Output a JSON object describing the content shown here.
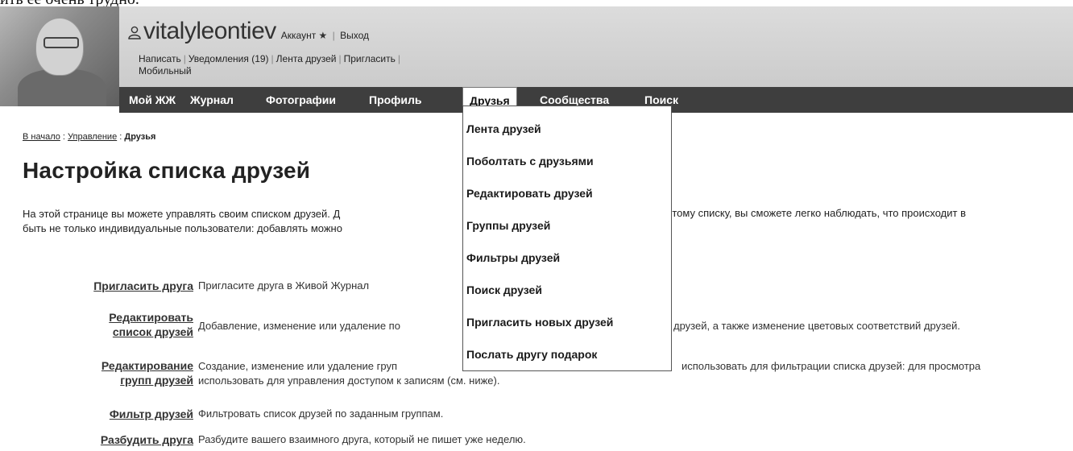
{
  "page_top_cut": "ить ее очень трудно.",
  "header": {
    "username": "vitalyleontiev",
    "account_link": "Аккаунт",
    "logout_link": "Выход",
    "sub_links": [
      "Написать",
      "Уведомления (19)",
      "Лента друзей",
      "Пригласить",
      "Мобильный"
    ]
  },
  "nav": {
    "items": [
      "Мой ЖЖ",
      "Журнал",
      "Фотографии",
      "Профиль",
      "Друзья",
      "Сообщества",
      "Поиск"
    ],
    "active_index": 4
  },
  "dropdown": {
    "items": [
      "Лента друзей",
      "Поболтать с друзьями",
      "Редактировать друзей",
      "Группы друзей",
      "Фильтры друзей",
      "Поиск друзей",
      "Пригласить новых друзей",
      "Послать другу подарок"
    ]
  },
  "breadcrumb": {
    "home": "В начало",
    "manage": "Управление",
    "current": "Друзья"
  },
  "page_title": "Настройка списка друзей",
  "intro": {
    "line1": "На этой странице вы можете управлять своим списком друзей. Д",
    "line1_end": "этому списку, вы сможете легко наблюдать, что происходит в",
    "line2": "быть не только индивидуальные пользователи: добавлять можно"
  },
  "rows": [
    {
      "link": [
        "Пригласить друга"
      ],
      "desc": [
        "Пригласите друга в Живой Журнал"
      ]
    },
    {
      "link": [
        "Редактировать",
        "список друзей"
      ],
      "desc": [
        "Добавление, изменение или удаление по",
        "друзей, а также изменение цветовых соответствий друзей."
      ]
    },
    {
      "link": [
        "Редактирование",
        "групп друзей"
      ],
      "desc": [
        "Создание, изменение или удаление груп",
        "использовать для фильтрации списка друзей: для просмотра",
        "использовать для управления доступом к записям (см. ниже)."
      ]
    },
    {
      "link": [
        "Фильтр друзей"
      ],
      "desc": [
        "Фильтровать список друзей по заданным группам."
      ]
    },
    {
      "link": [
        "Разбудить друга"
      ],
      "desc": [
        "Разбудите вашего взаимного друга, который не пишет уже неделю."
      ]
    }
  ]
}
